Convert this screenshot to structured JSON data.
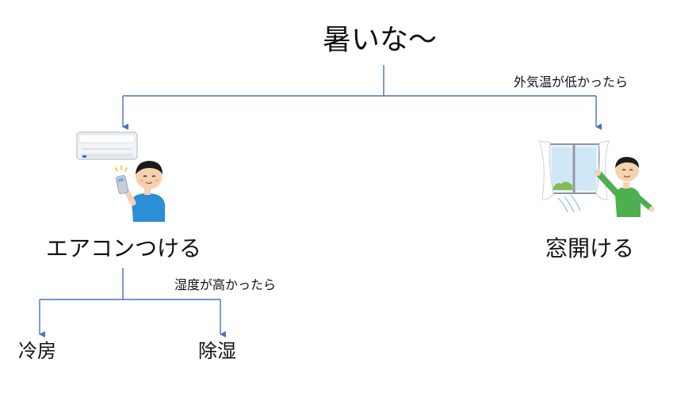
{
  "root": {
    "text": "暑いな〜"
  },
  "branches": {
    "aircon": {
      "label": "エアコンつける"
    },
    "window": {
      "label": "窓開ける",
      "condition": "外気温が低かったら"
    }
  },
  "aircon_children": {
    "cool": {
      "label": "冷房"
    },
    "dry": {
      "label": "除湿",
      "condition": "湿度が高かったら"
    }
  },
  "colors": {
    "connector": "#4a72b8",
    "text": "#111111",
    "shirt_blue": "#2a8fd6",
    "shirt_green": "#4caf50",
    "hair": "#1b1b1b",
    "skin": "#f6d2ae"
  },
  "icons": [
    "air-conditioner-icon",
    "remote-control-person-icon",
    "window-icon",
    "window-opening-person-icon"
  ]
}
